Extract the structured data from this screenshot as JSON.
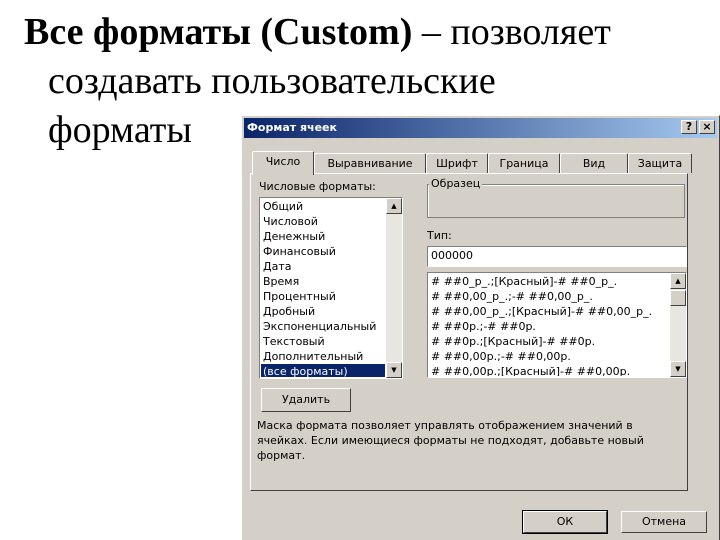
{
  "slide": {
    "bold_part": "Все форматы (Custom)",
    "rest_part": " – позволяет",
    "line2": "создавать пользовательские",
    "line3": "форматы"
  },
  "dialog": {
    "title": "Формат ячеек",
    "help_label": "?",
    "close_label": "×",
    "tabs": [
      {
        "label": "Число"
      },
      {
        "label": "Выравнивание"
      },
      {
        "label": "Шрифт"
      },
      {
        "label": "Граница"
      },
      {
        "label": "Вид"
      },
      {
        "label": "Защита"
      }
    ],
    "category_label": "Числовые форматы:",
    "categories": [
      "Общий",
      "Числовой",
      "Денежный",
      "Финансовый",
      "Дата",
      "Время",
      "Процентный",
      "Дробный",
      "Экспоненциальный",
      "Текстовый",
      "Дополнительный",
      "(все форматы)"
    ],
    "selected_category": "(все форматы)",
    "sample_label": "Образец",
    "type_label": "Тип:",
    "type_value": "000000",
    "formats": [
      "# ##0_р_.;[Красный]-# ##0_р_.",
      "# ##0,00_р_.;-# ##0,00_р_.",
      "# ##0,00_р_.;[Красный]-# ##0,00_р_.",
      "# ##0р.;-# ##0р.",
      "# ##0р.;[Красный]-# ##0р.",
      "# ##0,00р.;-# ##0,00р.",
      "# ##0,00р.;[Красный]-# ##0,00р."
    ],
    "delete_label": "Удалить",
    "description": [
      "Маска формата позволяет управлять отображением значений в",
      "ячейках. Если имеющиеся форматы не подходят, добавьте новый",
      "формат."
    ],
    "ok_label": "ОК",
    "cancel_label": "Отмена"
  }
}
